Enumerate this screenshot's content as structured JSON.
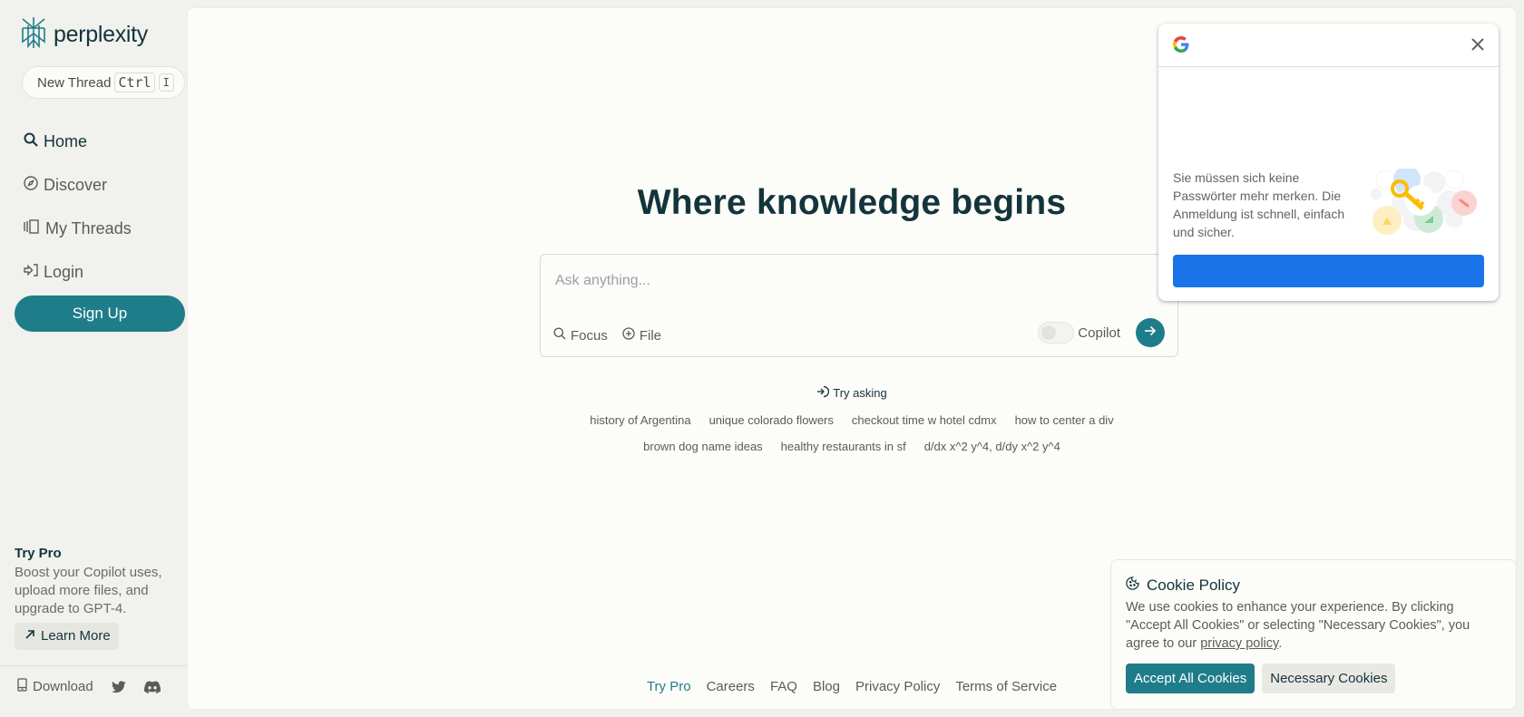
{
  "brand": {
    "name": "perplexity",
    "accent_color": "#1f7d8a",
    "text_color": "#13343b"
  },
  "sidebar": {
    "new_thread": {
      "label": "New Thread",
      "shortcut_keys": [
        "Ctrl",
        "I"
      ]
    },
    "nav": [
      {
        "label": "Home",
        "icon": "search-icon",
        "active": true
      },
      {
        "label": "Discover",
        "icon": "compass-icon",
        "active": false
      },
      {
        "label": "My Threads",
        "icon": "library-icon",
        "active": false
      },
      {
        "label": "Login",
        "icon": "login-icon",
        "active": false
      }
    ],
    "signup_label": "Sign Up",
    "try_pro": {
      "title": "Try Pro",
      "description": "Boost your Copilot uses, upload more files, and upgrade to GPT-4.",
      "learn_more_label": "Learn More"
    },
    "footer": {
      "download_label": "Download",
      "social": [
        "twitter-icon",
        "discord-icon"
      ]
    }
  },
  "main": {
    "headline": "Where knowledge begins",
    "search": {
      "placeholder": "Ask anything...",
      "value": "",
      "focus_label": "Focus",
      "file_label": "File",
      "copilot_label": "Copilot",
      "copilot_enabled": false
    },
    "try_asking": {
      "label": "Try asking",
      "suggestions_row1": [
        "history of Argentina",
        "unique colorado flowers",
        "checkout time w hotel cdmx",
        "how to center a div"
      ],
      "suggestions_row2": [
        "brown dog name ideas",
        "healthy restaurants in sf",
        "d/dx x^2 y^4, d/dy x^2 y^4"
      ]
    },
    "footer_links": [
      "Try Pro",
      "Careers",
      "FAQ",
      "Blog",
      "Privacy Policy",
      "Terms of Service"
    ]
  },
  "google_popup": {
    "message": "Sie müssen sich keine Passwörter mehr merken. Die Anmeldung ist schnell, einfach und sicher.",
    "button_label": "",
    "button_color": "#1a73e8"
  },
  "cookie_banner": {
    "title": "Cookie Policy",
    "text_before_link": "We use cookies to enhance your experience. By clicking \"Accept All Cookies\" or selecting \"Necessary Cookies\", you agree to our ",
    "link_text": "privacy policy",
    "text_after_link": ".",
    "accept_label": "Accept All Cookies",
    "necessary_label": "Necessary Cookies"
  }
}
